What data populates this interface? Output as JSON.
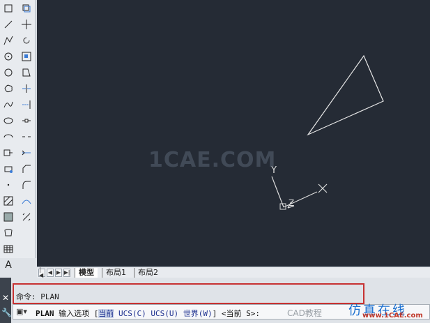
{
  "toolbar": {
    "left_icons": [
      "rectangle-icon",
      "line-icon",
      "polyline-icon",
      "arc-icon",
      "circle-icon",
      "revcloud-icon",
      "spline-icon",
      "ellipse-icon",
      "ellipse-arc-icon",
      "insert-block-icon",
      "make-block-icon",
      "point-icon",
      "hatch-icon",
      "gradient-icon",
      "region-icon",
      "table-icon",
      "mtext-icon",
      "add-selected-icon"
    ],
    "right_icons": [
      "copy-icon",
      "move-icon",
      "rotate-icon",
      "scale-icon",
      "stretch-icon",
      "trim-icon",
      "extend-icon",
      "break-at-point-icon",
      "break-icon",
      "join-icon",
      "chamfer-icon",
      "fillet-icon",
      "blend-icon",
      "explode-icon"
    ],
    "text_glyph": "A"
  },
  "canvas": {
    "background": "#252b35",
    "watermark": "1CAE.COM",
    "ucs": {
      "y_label": "Y",
      "x_label": "X",
      "z_label": "Z"
    }
  },
  "tabs": {
    "nav": [
      "|◀",
      "◀",
      "▶",
      "▶|"
    ],
    "items": [
      "模型",
      "布局1",
      "布局2"
    ]
  },
  "command": {
    "history": "命令: PLAN",
    "icon": "▣▾",
    "prompt_cmd": "PLAN",
    "prompt_text": "输入选项",
    "bracket_open": "[",
    "opt_current": "当前",
    "opt_ucs_c": "UCS(C)",
    "opt_ucs_u": "UCS(U)",
    "opt_world": "世界(W)",
    "bracket_close": "]",
    "default_text": "<当前",
    "default_key": "S>:"
  },
  "overlay": {
    "wechat": "CAD教程",
    "site_badge": "仿真在线",
    "site_url": "www.1CAE.com"
  }
}
